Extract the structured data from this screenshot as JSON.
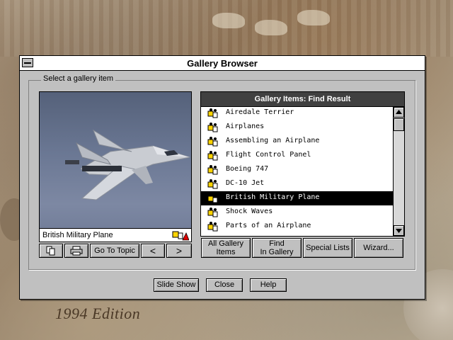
{
  "window": {
    "title": "Gallery Browser"
  },
  "group": {
    "label": "Select a gallery item"
  },
  "preview": {
    "caption": "British Military Plane",
    "toolbar": {
      "go_to_topic": "Go To Topic",
      "prev_glyph": "<",
      "next_glyph": ">"
    }
  },
  "list": {
    "header": "Gallery Items: Find Result",
    "items": [
      {
        "label": "Airedale Terrier"
      },
      {
        "label": "Airplanes"
      },
      {
        "label": "Assembling an Airplane"
      },
      {
        "label": "Flight Control Panel"
      },
      {
        "label": "Boeing 747"
      },
      {
        "label": "DC-10 Jet"
      },
      {
        "label": "British Military Plane",
        "selected": true
      },
      {
        "label": "Shock Waves"
      },
      {
        "label": "Parts of an Airplane"
      }
    ],
    "buttons": {
      "all_items_1": "All Gallery",
      "all_items_2": "Items",
      "find_1": "Find",
      "find_2": "In Gallery",
      "special": "Special Lists",
      "wizard": "Wizard..."
    }
  },
  "footer": {
    "slide_show": "Slide Show",
    "close": "Close",
    "help": "Help"
  },
  "desktop": {
    "edition": "1994 Edition"
  }
}
